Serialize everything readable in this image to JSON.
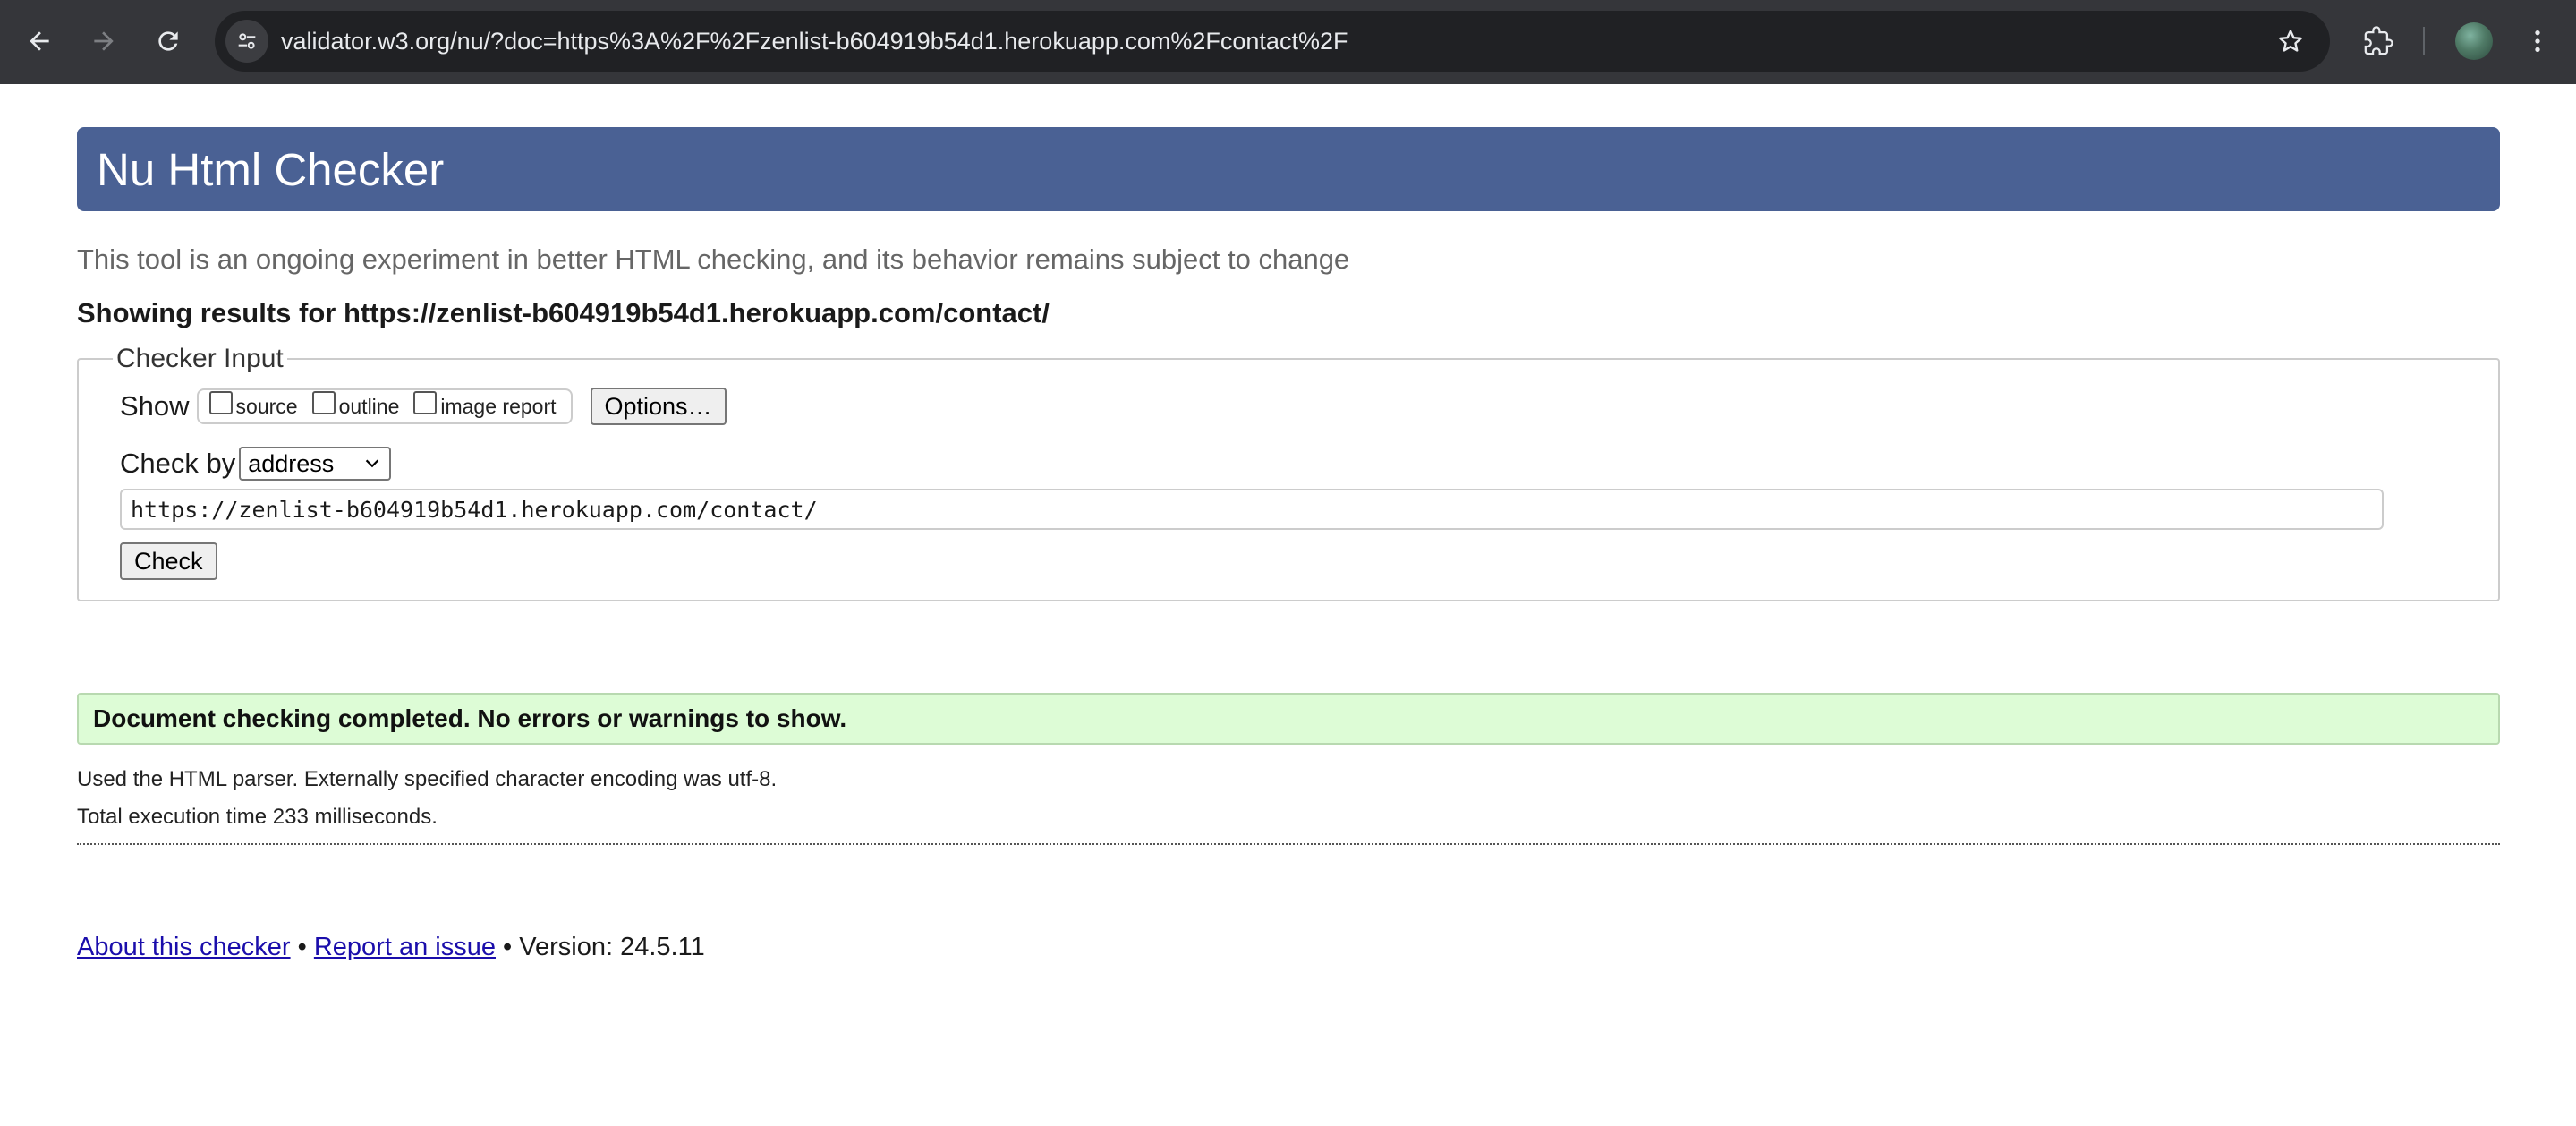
{
  "browser": {
    "url": "validator.w3.org/nu/?doc=https%3A%2F%2Fzenlist-b604919b54d1.herokuapp.com%2Fcontact%2F",
    "icons": {
      "back": "arrow-left-icon",
      "forward": "arrow-right-icon",
      "reload": "reload-icon",
      "site_info": "tune-icon",
      "bookmark": "star-icon",
      "extensions": "puzzle-icon",
      "menu": "kebab-menu-icon"
    }
  },
  "page": {
    "title": "Nu Html Checker",
    "tagline": "This tool is an ongoing experiment in better HTML checking, and its behavior remains subject to change",
    "showing_results": "Showing results for https://zenlist-b604919b54d1.herokuapp.com/contact/",
    "checker": {
      "legend": "Checker Input",
      "show_label": "Show",
      "show_options": [
        {
          "label": "source",
          "checked": false
        },
        {
          "label": "outline",
          "checked": false
        },
        {
          "label": "image report",
          "checked": false
        }
      ],
      "options_button": "Options…",
      "check_by_label": "Check by",
      "check_by_value": "address",
      "url_value": "https://zenlist-b604919b54d1.herokuapp.com/contact/",
      "check_button": "Check"
    },
    "result": {
      "message": "Document checking completed. No errors or warnings to show.",
      "parser_line": "Used the HTML parser. Externally specified character encoding was utf-8.",
      "time_line": "Total execution time 233 milliseconds."
    },
    "footer": {
      "about_link": "About this checker",
      "sep1": " • ",
      "report_link": "Report an issue",
      "version": " • Version: 24.5.11"
    }
  },
  "colors": {
    "title_bar": "#4a6194",
    "success_bg": "#ddfcd6",
    "link": "#1a0dab",
    "chrome_bg": "#35363a"
  }
}
